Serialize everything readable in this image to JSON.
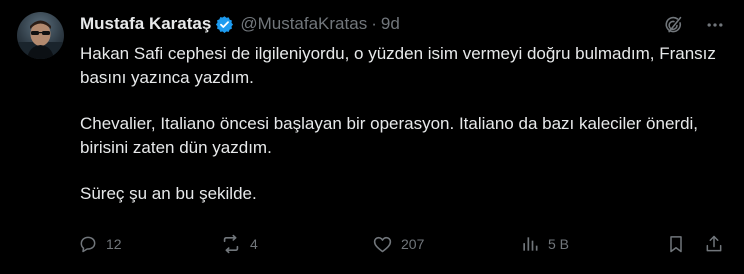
{
  "tweet": {
    "display_name": "Mustafa Karataş",
    "handle": "@MustafaKratas",
    "separator": "·",
    "time": "9d",
    "paragraphs": [
      "Hakan Safi cephesi de ilgileniyordu, o yüzden isim vermeyi doğru bulmadım, Fransız basını yazınca yazdım.",
      "Chevalier, Italiano öncesi başlayan bir operasyon. Italiano da bazı kaleciler önerdi, birisini zaten dün yazdım.",
      "Süreç şu an bu şekilde."
    ],
    "actions": {
      "replies": "12",
      "reposts": "4",
      "likes": "207",
      "views": "5 B"
    }
  },
  "colors": {
    "background": "#000000",
    "text": "#e7e9ea",
    "muted": "#71767b",
    "verified": "#1d9bf0"
  },
  "icons": [
    "grok-icon",
    "more-icon",
    "reply-icon",
    "repost-icon",
    "like-icon",
    "views-icon",
    "bookmark-icon",
    "share-icon"
  ]
}
